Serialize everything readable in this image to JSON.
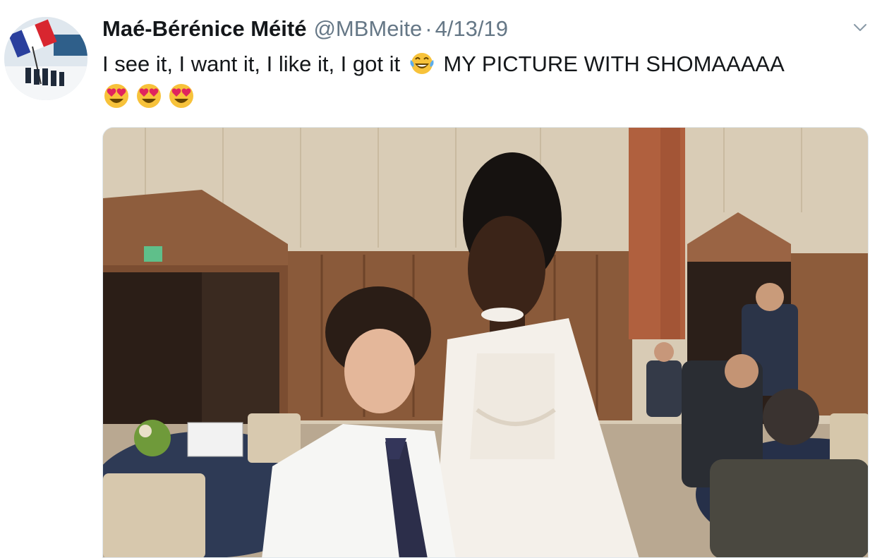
{
  "tweet": {
    "display_name": "Maé-Bérénice Méité",
    "handle": "@MBMeite",
    "separator": "·",
    "date": "4/13/19",
    "text_before_emoji": "I see it, I want it, I like it, I got it",
    "text_after_emoji": "MY PICTURE WITH SHOMAAAAA",
    "inline_emoji": "face-with-tears-of-joy",
    "trailing_emojis": [
      "heart-eyes",
      "heart-eyes",
      "heart-eyes"
    ]
  },
  "icons": {
    "caret": "chevron-down-icon",
    "avatar": "avatar-flag-photo"
  },
  "colors": {
    "name": "#14171a",
    "secondary": "#657786",
    "emoji_yellow": "#f7c23a",
    "heart": "#e0245e"
  }
}
